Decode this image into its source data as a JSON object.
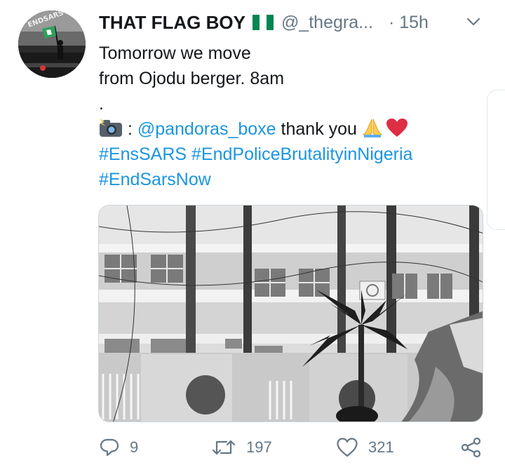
{
  "tweet": {
    "author_name": "THAT FLAG BOY",
    "handle": "@_thegra...",
    "time": "· 15h",
    "lines": {
      "line1": "Tomorrow we move",
      "line2": "from Ojodu berger. 8am",
      "line3": ".",
      "camera_sep": " : ",
      "mention": "@pandoras_boxe",
      "thanks": " thank you ",
      "hashtag1": "#EnsSARS",
      "hashtag2": "#EndPoliceBrutalityinNigeria",
      "hashtag3": "#EndSarsNow"
    },
    "stats": {
      "replies": "9",
      "retweets": "197",
      "likes": "321"
    }
  },
  "colors": {
    "link": "#1b95e0",
    "muted": "#657786",
    "flag_green": "#008751",
    "heart_red": "#dd2e44"
  },
  "icons": {
    "caret": "chevron-down-icon",
    "reply": "reply-icon",
    "retweet": "retweet-icon",
    "like": "heart-icon",
    "share": "share-icon",
    "camera": "camera-flash-emoji",
    "pray": "folded-hands-emoji",
    "heart_emoji": "red-heart-emoji"
  }
}
